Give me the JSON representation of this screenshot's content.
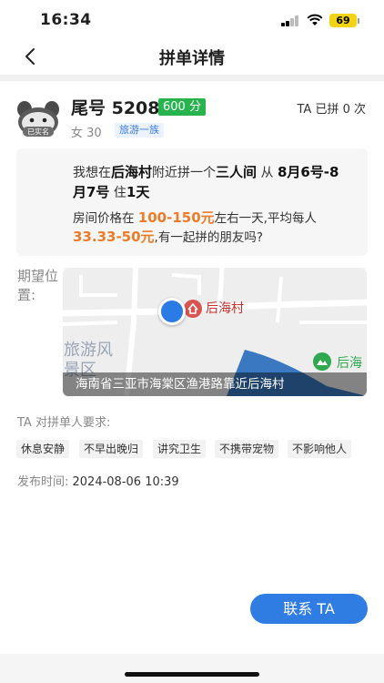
{
  "status_bar": {
    "time": "16:34",
    "battery": "69"
  },
  "nav": {
    "title": "拼单详情"
  },
  "user": {
    "tail_number": "尾号 5208",
    "score": "600 分",
    "pin_count": "TA 已拼 0 次",
    "gender_age": "女 30",
    "tag": "旅游一族",
    "avatar_label": "已实名"
  },
  "request": {
    "line1_prefix": "我想在",
    "place": "后海村",
    "line1_mid": "附近拼一个",
    "room_type": "三人间",
    "line1_from": " 从 ",
    "date_range": "8月6号-8月7号",
    "stay_prefix": " 住",
    "stay": "1天",
    "price_prefix": "房间价格在 ",
    "price_range": "100-150元",
    "price_mid": "左右一天,平均每人 ",
    "per_person": "33.33-50元",
    "price_suffix": ",有一起拼的朋友吗?"
  },
  "location": {
    "label": "期望位置:",
    "poi_main": "后海村",
    "poi_secondary": "后海",
    "poi_tourism": "旅游风景区",
    "address": "海南省三亚市海棠区渔港路靠近后海村"
  },
  "requirements": {
    "title": "TA 对拼单人要求:",
    "tags": [
      "休息安静",
      "不早出晚归",
      "讲究卫生",
      "不携带宠物",
      "不影响他人"
    ]
  },
  "publish": {
    "label": "发布时间: ",
    "time": "2024-08-06 10:39"
  },
  "contact_button": {
    "label": "联系 TA"
  },
  "colors": {
    "accent": "#2f7de3",
    "price": "#ee7b28",
    "badge": "#27b34d"
  }
}
